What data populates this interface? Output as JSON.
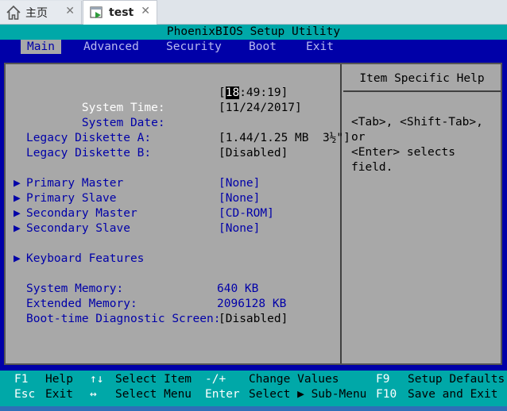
{
  "tabs": [
    {
      "label": "主页",
      "icon": "home-icon"
    },
    {
      "label": "test",
      "icon": "vm-icon"
    }
  ],
  "bios": {
    "title": "PhoenixBIOS Setup Utility",
    "menu": [
      "Main",
      "Advanced",
      "Security",
      "Boot",
      "Exit"
    ],
    "rows": {
      "system_time_label": "System Time:",
      "system_time_cursor": "18",
      "system_time_rest": ":49:19]",
      "system_date_label": "System Date:",
      "system_date_value": "[11/24/2017]",
      "legacy_a_label": "Legacy Diskette A:",
      "legacy_a_value": "[1.44/1.25 MB  3½\"]",
      "legacy_b_label": "Legacy Diskette B:",
      "legacy_b_value": "[Disabled]",
      "primary_master_label": "Primary Master",
      "primary_master_value": "[None]",
      "primary_slave_label": "Primary Slave",
      "primary_slave_value": "[None]",
      "secondary_master_label": "Secondary Master",
      "secondary_master_value": "[CD-ROM]",
      "secondary_slave_label": "Secondary Slave",
      "secondary_slave_value": "[None]",
      "keyboard_label": "Keyboard Features",
      "system_memory_label": "System Memory:",
      "system_memory_value": "640 KB",
      "extended_memory_label": "Extended Memory:",
      "extended_memory_value": "2096128 KB",
      "boot_diag_label": "Boot-time Diagnostic Screen:",
      "boot_diag_value": "[Disabled]"
    },
    "help": {
      "title": "Item Specific Help",
      "line1": "<Tab>, <Shift-Tab>, or",
      "line2": "<Enter> selects field."
    },
    "status": {
      "f1_key": "F1",
      "f1_desc": "Help",
      "updown_key": "↑↓",
      "updown_desc": "Select Item",
      "plusminus_key": "-/+",
      "plusminus_desc": "Change Values",
      "f9_key": "F9",
      "f9_desc": "Setup Defaults",
      "esc_key": "Esc",
      "esc_desc": "Exit",
      "leftright_key": "↔",
      "leftright_desc": "Select Menu",
      "enter_key": "Enter",
      "enter_desc": "Select ▶ Sub-Menu",
      "f10_key": "F10",
      "f10_desc": "Save and Exit"
    }
  },
  "colors": {
    "bios_blue": "#0000a8",
    "bios_cyan": "#00a8a8",
    "bios_gray": "#a8a8a8"
  }
}
